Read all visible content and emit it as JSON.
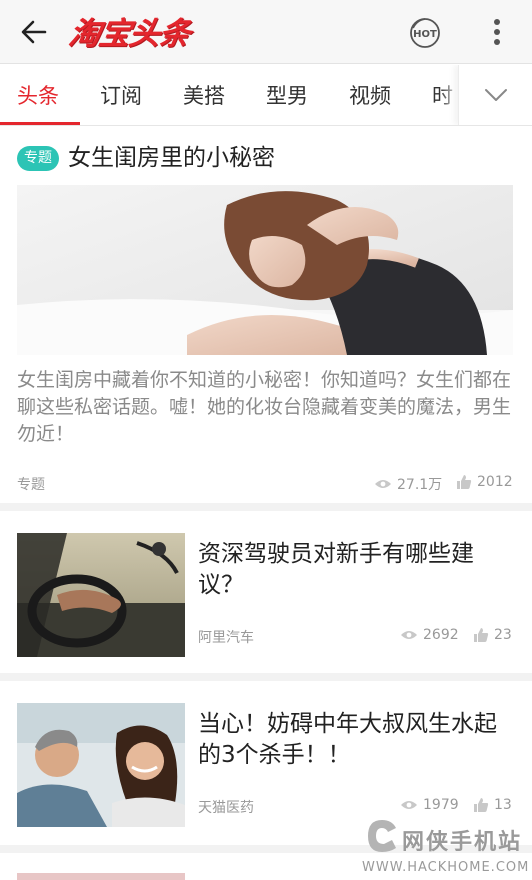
{
  "appbar": {
    "logo_text": "淘宝头条",
    "icons": [
      "back-arrow-icon",
      "hot-icon",
      "more-vertical-icon"
    ],
    "brand_color": "#e4262d"
  },
  "tabs": {
    "items": [
      "头条",
      "订阅",
      "美搭",
      "型男",
      "视频",
      "时"
    ],
    "active_index": 0
  },
  "feature": {
    "badge": "专题",
    "badge_color": "#2cc4b5",
    "title": "女生闺房里的小秘密",
    "description": "女生闺房中藏着你不知道的小秘密！你知道吗？女生们都在聊这些私密话题。嘘！她的化妆台隐藏着变美的魔法，男生勿近！",
    "source": "专题",
    "views": "27.1万",
    "likes": "2012"
  },
  "articles": [
    {
      "title": "资深驾驶员对新手有哪些建议？",
      "source": "阿里汽车",
      "views": "2692",
      "likes": "23"
    },
    {
      "title": "当心！妨碍中年大叔风生水起的3个杀手！！",
      "source": "天猫医药",
      "views": "1979",
      "likes": "13"
    }
  ],
  "watermark": {
    "text": "网侠手机站",
    "url": "WWW.HACKHOME.COM"
  }
}
